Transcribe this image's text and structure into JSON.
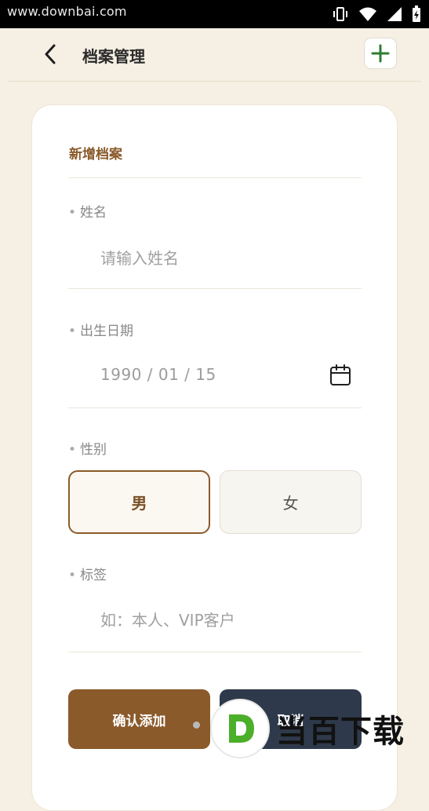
{
  "status_bar": {
    "watermark_text": "www.downbai.com",
    "icons": [
      "vibrate-icon",
      "wifi-icon",
      "signal-icon",
      "battery-charging-icon"
    ]
  },
  "header": {
    "back_icon": "chevron-left-icon",
    "title": "档案管理",
    "add_icon": "plus-icon",
    "accent_color": "#2e7d32"
  },
  "form": {
    "heading": "新增档案",
    "name": {
      "label": "姓名",
      "placeholder": "请输入姓名",
      "value": ""
    },
    "birthdate": {
      "label": "出生日期",
      "value": "1990 / 01 / 15",
      "icon": "calendar-icon"
    },
    "gender": {
      "label": "性别",
      "options": [
        "男",
        "女"
      ],
      "selected": "男"
    },
    "tag": {
      "label": "标签",
      "placeholder": "如：本人、VIP客户",
      "value": ""
    },
    "confirm_button": "确认添加",
    "second_button": "取消"
  },
  "watermark": {
    "letter": "D",
    "text": "当百下载"
  },
  "colors": {
    "background": "#f6f0e4",
    "brand_brown": "#8b5a2b",
    "dark_navy": "#2e3a4b",
    "plus_green": "#2e7d32"
  }
}
